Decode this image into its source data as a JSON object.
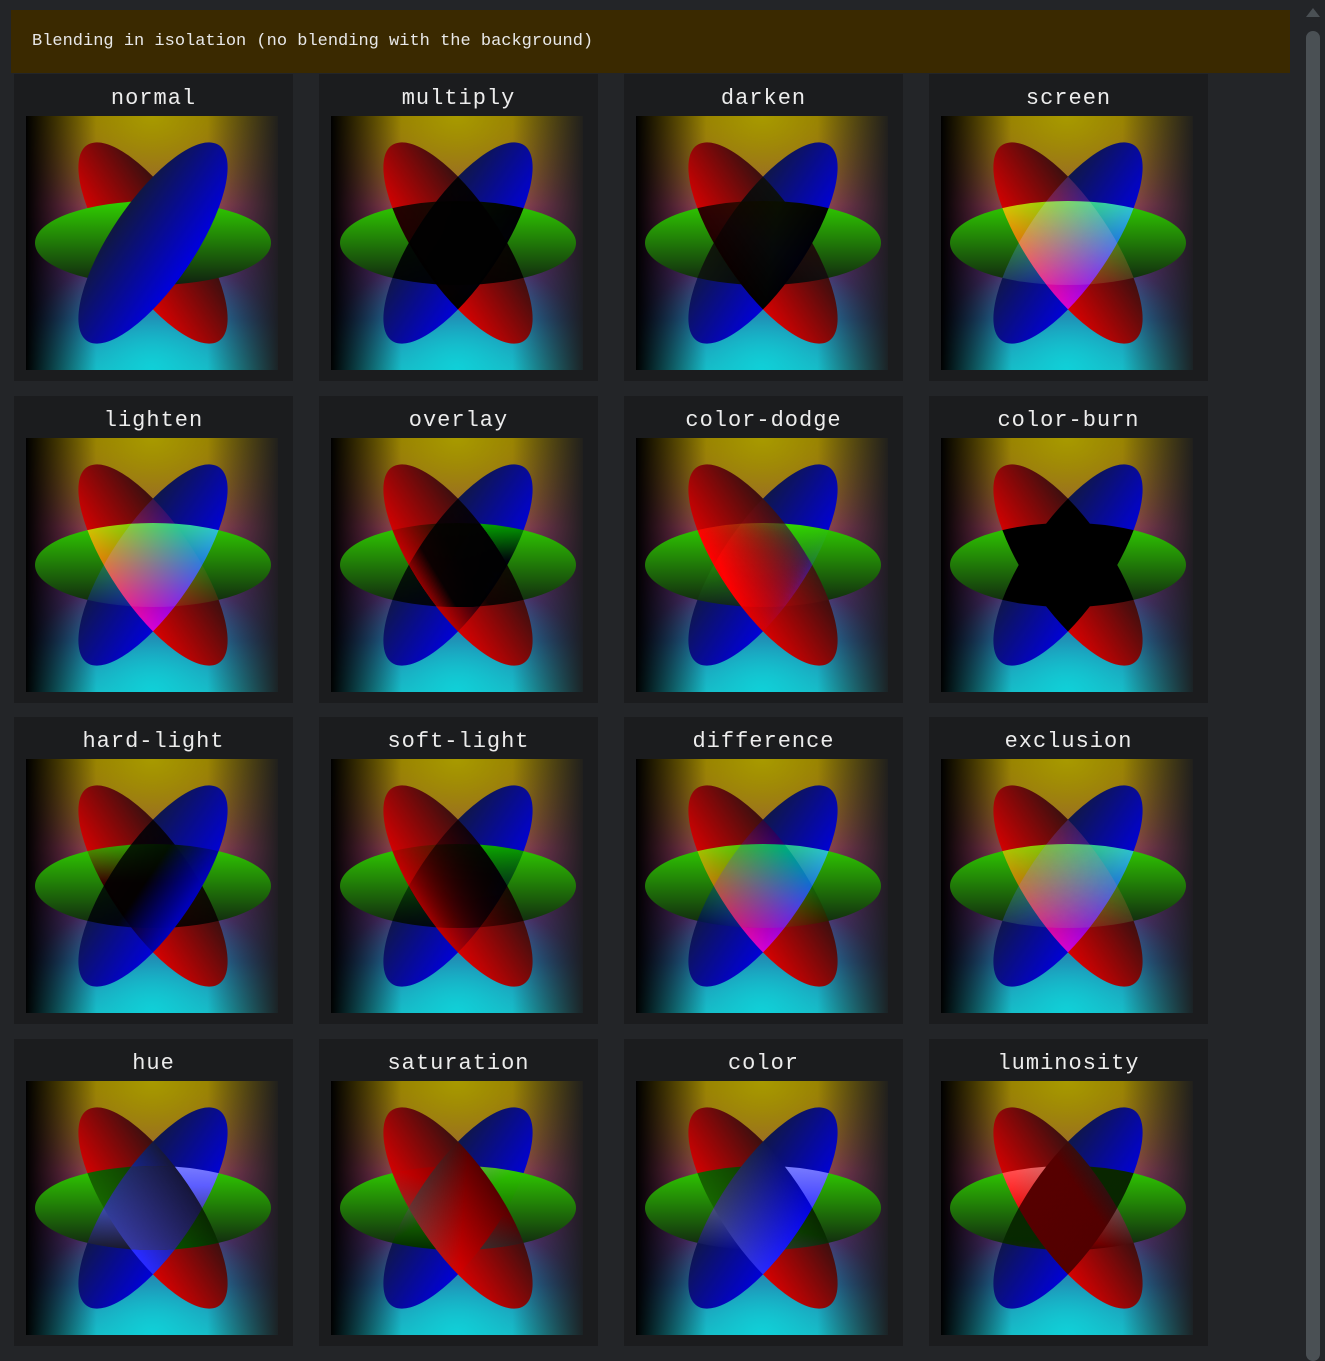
{
  "banner": {
    "text": "Blending in isolation (no blending with the background)"
  },
  "modes": [
    "normal",
    "multiply",
    "darken",
    "screen",
    "lighten",
    "overlay",
    "color-dodge",
    "color-burn",
    "hard-light",
    "soft-light",
    "difference",
    "exclusion",
    "hue",
    "saturation",
    "color",
    "luminosity"
  ],
  "colors": {
    "banner_bg": "#3a2900",
    "tile_bg": "#1b1c1e",
    "page_bg": "#232528"
  }
}
